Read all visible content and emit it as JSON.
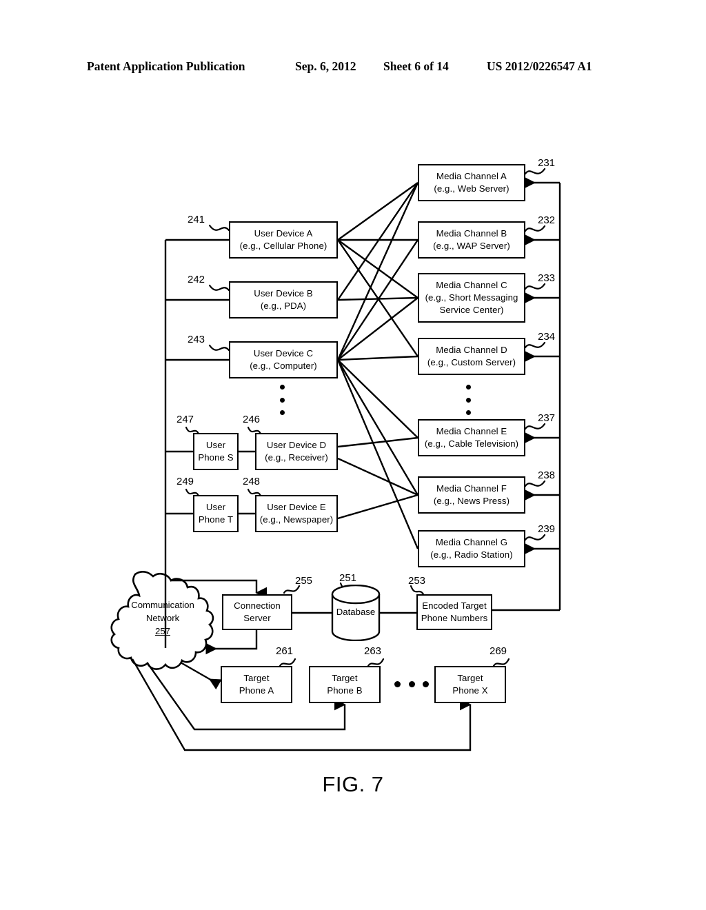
{
  "header": {
    "title": "Patent Application Publication",
    "date": "Sep. 6, 2012",
    "sheet": "Sheet 6 of 14",
    "pub_number": "US 2012/0226547 A1"
  },
  "figure": {
    "caption": "FIG. 7"
  },
  "media_channels": [
    {
      "ref": "231",
      "line1": "Media Channel  A",
      "line2": "(e.g., Web Server)"
    },
    {
      "ref": "232",
      "line1": "Media Channel  B",
      "line2": "(e.g., WAP Server)"
    },
    {
      "ref": "233",
      "line1": "Media Channel  C",
      "line2": "(e.g., Short Messaging",
      "line3": "Service Center)"
    },
    {
      "ref": "234",
      "line1": "Media Channel  D",
      "line2": "(e.g., Custom Server)"
    },
    {
      "ref": "237",
      "line1": "Media Channel  E",
      "line2": "(e.g., Cable Television)"
    },
    {
      "ref": "238",
      "line1": "Media Channel  F",
      "line2": "(e.g., News Press)"
    },
    {
      "ref": "239",
      "line1": "Media Channel  G",
      "line2": "(e.g., Radio Station)"
    }
  ],
  "user_devices": [
    {
      "ref": "241",
      "line1": "User Device  A",
      "line2": "(e.g., Cellular Phone)"
    },
    {
      "ref": "242",
      "line1": "User Device  B",
      "line2": "(e.g., PDA)"
    },
    {
      "ref": "243",
      "line1": "User Device  C",
      "line2": "(e.g., Computer)"
    },
    {
      "ref": "246",
      "line1": "User Device  D",
      "line2": "(e.g., Receiver)"
    },
    {
      "ref": "248",
      "line1": "User Device  E",
      "line2": "(e.g., Newspaper)"
    }
  ],
  "user_phones": [
    {
      "ref": "247",
      "line1": "User",
      "line2": "Phone S"
    },
    {
      "ref": "249",
      "line1": "User",
      "line2": "Phone T"
    }
  ],
  "infrastructure": {
    "cloud": {
      "ref": "257",
      "line1": "Communication",
      "line2": "Network"
    },
    "connection_server": {
      "ref": "255",
      "line1": "Connection",
      "line2": "Server"
    },
    "database": {
      "ref": "251",
      "label": "Database"
    },
    "encoded_numbers": {
      "ref": "253",
      "line1": "Encoded Target",
      "line2": "Phone Numbers"
    }
  },
  "target_phones": [
    {
      "ref": "261",
      "line1": "Target",
      "line2": "Phone A"
    },
    {
      "ref": "263",
      "line1": "Target",
      "line2": "Phone B"
    },
    {
      "ref": "269",
      "line1": "Target",
      "line2": "Phone X"
    }
  ],
  "colors": {
    "ink": "#000000",
    "paper": "#ffffff"
  }
}
